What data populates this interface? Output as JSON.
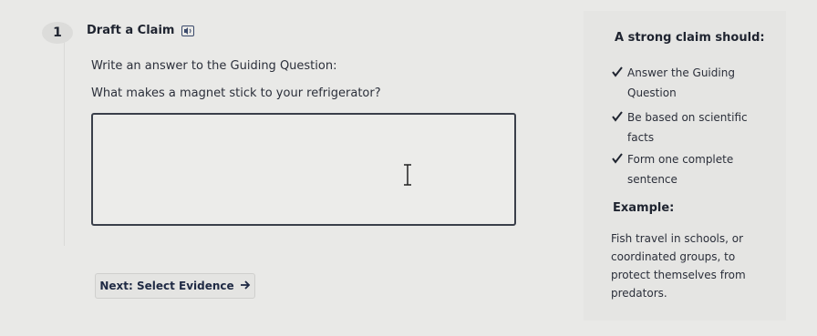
{
  "step": {
    "number": "1",
    "title": "Draft a Claim",
    "icon": "read-aloud-icon"
  },
  "prompt": {
    "instruction": "Write an answer to the Guiding Question:",
    "question": "What makes a magnet stick to your refrigerator?"
  },
  "answer": {
    "value": ""
  },
  "next_button": {
    "label": "Next: Select Evidence",
    "icon": "arrow-right-icon"
  },
  "criteria": {
    "heading": "A strong claim should:",
    "items": [
      {
        "line1": "Answer the Guiding",
        "line2": "Question"
      },
      {
        "line1": "Be based on scientific",
        "line2": "facts"
      },
      {
        "line1": "Form one complete",
        "line2": "sentence"
      }
    ]
  },
  "example": {
    "heading": "Example:",
    "lines": [
      "Fish travel in schools, or",
      "coordinated groups, to",
      "protect themselves from",
      "predators."
    ]
  },
  "colors": {
    "background": "#e9e9e7",
    "text": "#2b2f3a",
    "button_text": "#1f2a44",
    "check": "#1f2430"
  }
}
